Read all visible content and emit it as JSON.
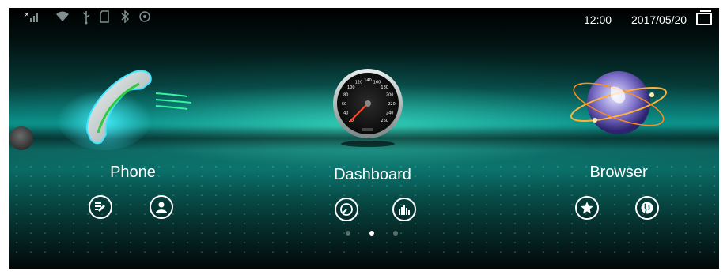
{
  "status_bar": {
    "time": "12:00",
    "date": "2017/05/20",
    "icons": [
      "no-signal-icon",
      "wifi-icon",
      "usb-icon",
      "sd-card-icon",
      "bluetooth-icon",
      "location-icon"
    ]
  },
  "apps": [
    {
      "label": "Phone",
      "icon": "phone-handset-icon",
      "actions": [
        "call-log-icon",
        "contacts-icon"
      ]
    },
    {
      "label": "Dashboard",
      "icon": "speedometer-icon",
      "actions": [
        "gauge-icon",
        "equalizer-icon"
      ]
    },
    {
      "label": "Browser",
      "icon": "globe-icon",
      "actions": [
        "star-icon",
        "globe-icon"
      ]
    }
  ],
  "speedometer": {
    "labels": [
      "20",
      "40",
      "60",
      "80",
      "100",
      "120",
      "140",
      "160",
      "180",
      "200",
      "220",
      "240",
      "260"
    ]
  },
  "pager": {
    "count": 3,
    "active": 1
  },
  "colors": {
    "accent": "#19d7c6",
    "glow": "#45f0ff",
    "text": "#ffffff"
  }
}
